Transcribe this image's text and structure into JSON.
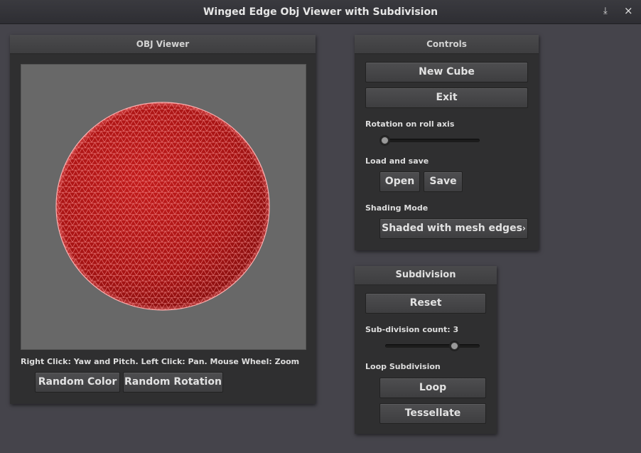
{
  "window": {
    "title": "Winged Edge Obj Viewer with Subdivision",
    "minimize_glyph": "⤓",
    "close_glyph": "×"
  },
  "obj_viewer": {
    "header": "OBJ Viewer",
    "hint": "Right Click: Yaw and Pitch. Left Click: Pan. Mouse Wheel: Zoom",
    "random_color_label": "Random Color",
    "random_rotation_label": "Random Rotation",
    "viewport_bg": "#686868",
    "mesh_color": "#b81818",
    "edge_color": "#ff9a9a"
  },
  "controls": {
    "header": "Controls",
    "new_cube_label": "New Cube",
    "exit_label": "Exit",
    "rotation_label": "Rotation on roll axis",
    "rotation_value": 0,
    "load_save_label": "Load and save",
    "open_label": "Open",
    "save_label": "Save",
    "shading_label": "Shading Mode",
    "shading_value": "Shaded with mesh edges",
    "dropdown_glyph": "›"
  },
  "subdivision": {
    "header": "Subdivision",
    "reset_label": "Reset",
    "count_label": "Sub-division count: 3",
    "count_fraction": 0.73,
    "loop_subdivision_label": "Loop Subdivision",
    "loop_label": "Loop",
    "tessellate_label": "Tessellate"
  }
}
